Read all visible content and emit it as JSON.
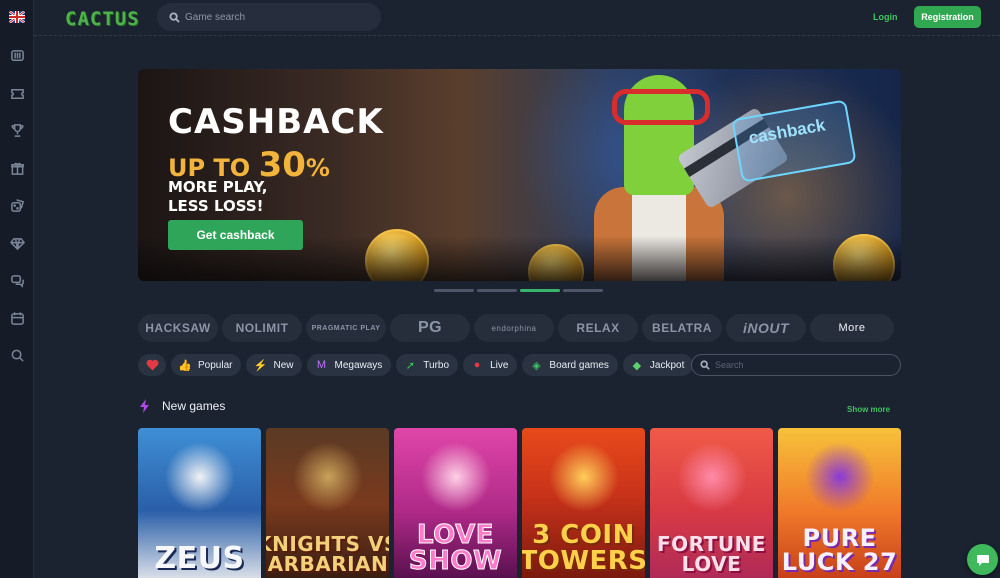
{
  "header": {
    "logo": "CACTUS",
    "search_placeholder": "Game search",
    "login_label": "Login",
    "register_label": "Registration"
  },
  "sidebar": {
    "language_icon": "uk-flag-icon",
    "items": [
      {
        "icon": "slots-icon"
      },
      {
        "icon": "ticket-icon"
      },
      {
        "icon": "trophy-icon"
      },
      {
        "icon": "gift-box-icon"
      },
      {
        "icon": "casino-dice-icon"
      },
      {
        "icon": "diamond-icon"
      },
      {
        "icon": "chat-bubbles-icon"
      },
      {
        "icon": "calendar-icon"
      },
      {
        "icon": "search-icon"
      }
    ]
  },
  "banner": {
    "title": "CASHBACK",
    "upto": "UP TO",
    "percent": "30",
    "percent_sign": "%",
    "subtitle_line1": "MORE PLAY,",
    "subtitle_line2": "LESS LOSS!",
    "button_label": "Get cashback",
    "holo_card_text": "cashback",
    "slides_count": 4,
    "active_slide": 3
  },
  "providers": [
    {
      "name": "HACKSAW",
      "key": "hacksaw"
    },
    {
      "name": "NOLIMIT",
      "key": "nolimit"
    },
    {
      "name": "PRAGMATIC PLAY",
      "key": "pragmatic"
    },
    {
      "name": "PG",
      "key": "pg"
    },
    {
      "name": "endorphina",
      "key": "endorphina"
    },
    {
      "name": "RELAX",
      "key": "relax"
    },
    {
      "name": "BELATRA",
      "key": "belatra"
    },
    {
      "name": "iNOUT",
      "key": "inout"
    },
    {
      "name": "More",
      "key": "more"
    }
  ],
  "categories": [
    {
      "label": "Popular",
      "icon": "thumbs-up-icon"
    },
    {
      "label": "New",
      "icon": "lightning-icon"
    },
    {
      "label": "Megaways",
      "icon": "megaways-icon"
    },
    {
      "label": "Turbo",
      "icon": "rocket-icon"
    },
    {
      "label": "Live",
      "icon": "live-camera-icon"
    },
    {
      "label": "Board games",
      "icon": "board-games-icon"
    },
    {
      "label": "Jackpot",
      "icon": "jackpot-diamond-icon"
    }
  ],
  "category_search_placeholder": "Search",
  "new_games": {
    "title": "New games",
    "show_more_label": "Show more",
    "games": [
      {
        "name": "ZEUS"
      },
      {
        "name": "KNIGHTS VS BARBARIANS"
      },
      {
        "name": "LOVE SHOW"
      },
      {
        "name": "3 COIN TOWERS"
      },
      {
        "name": "FORTUNE LOVE"
      },
      {
        "name": "PURE LUCK 27"
      }
    ]
  },
  "colors": {
    "accent_green": "#3ec35f",
    "page_bg": "#1b2230",
    "banner_highlight": "#f2b43a"
  }
}
